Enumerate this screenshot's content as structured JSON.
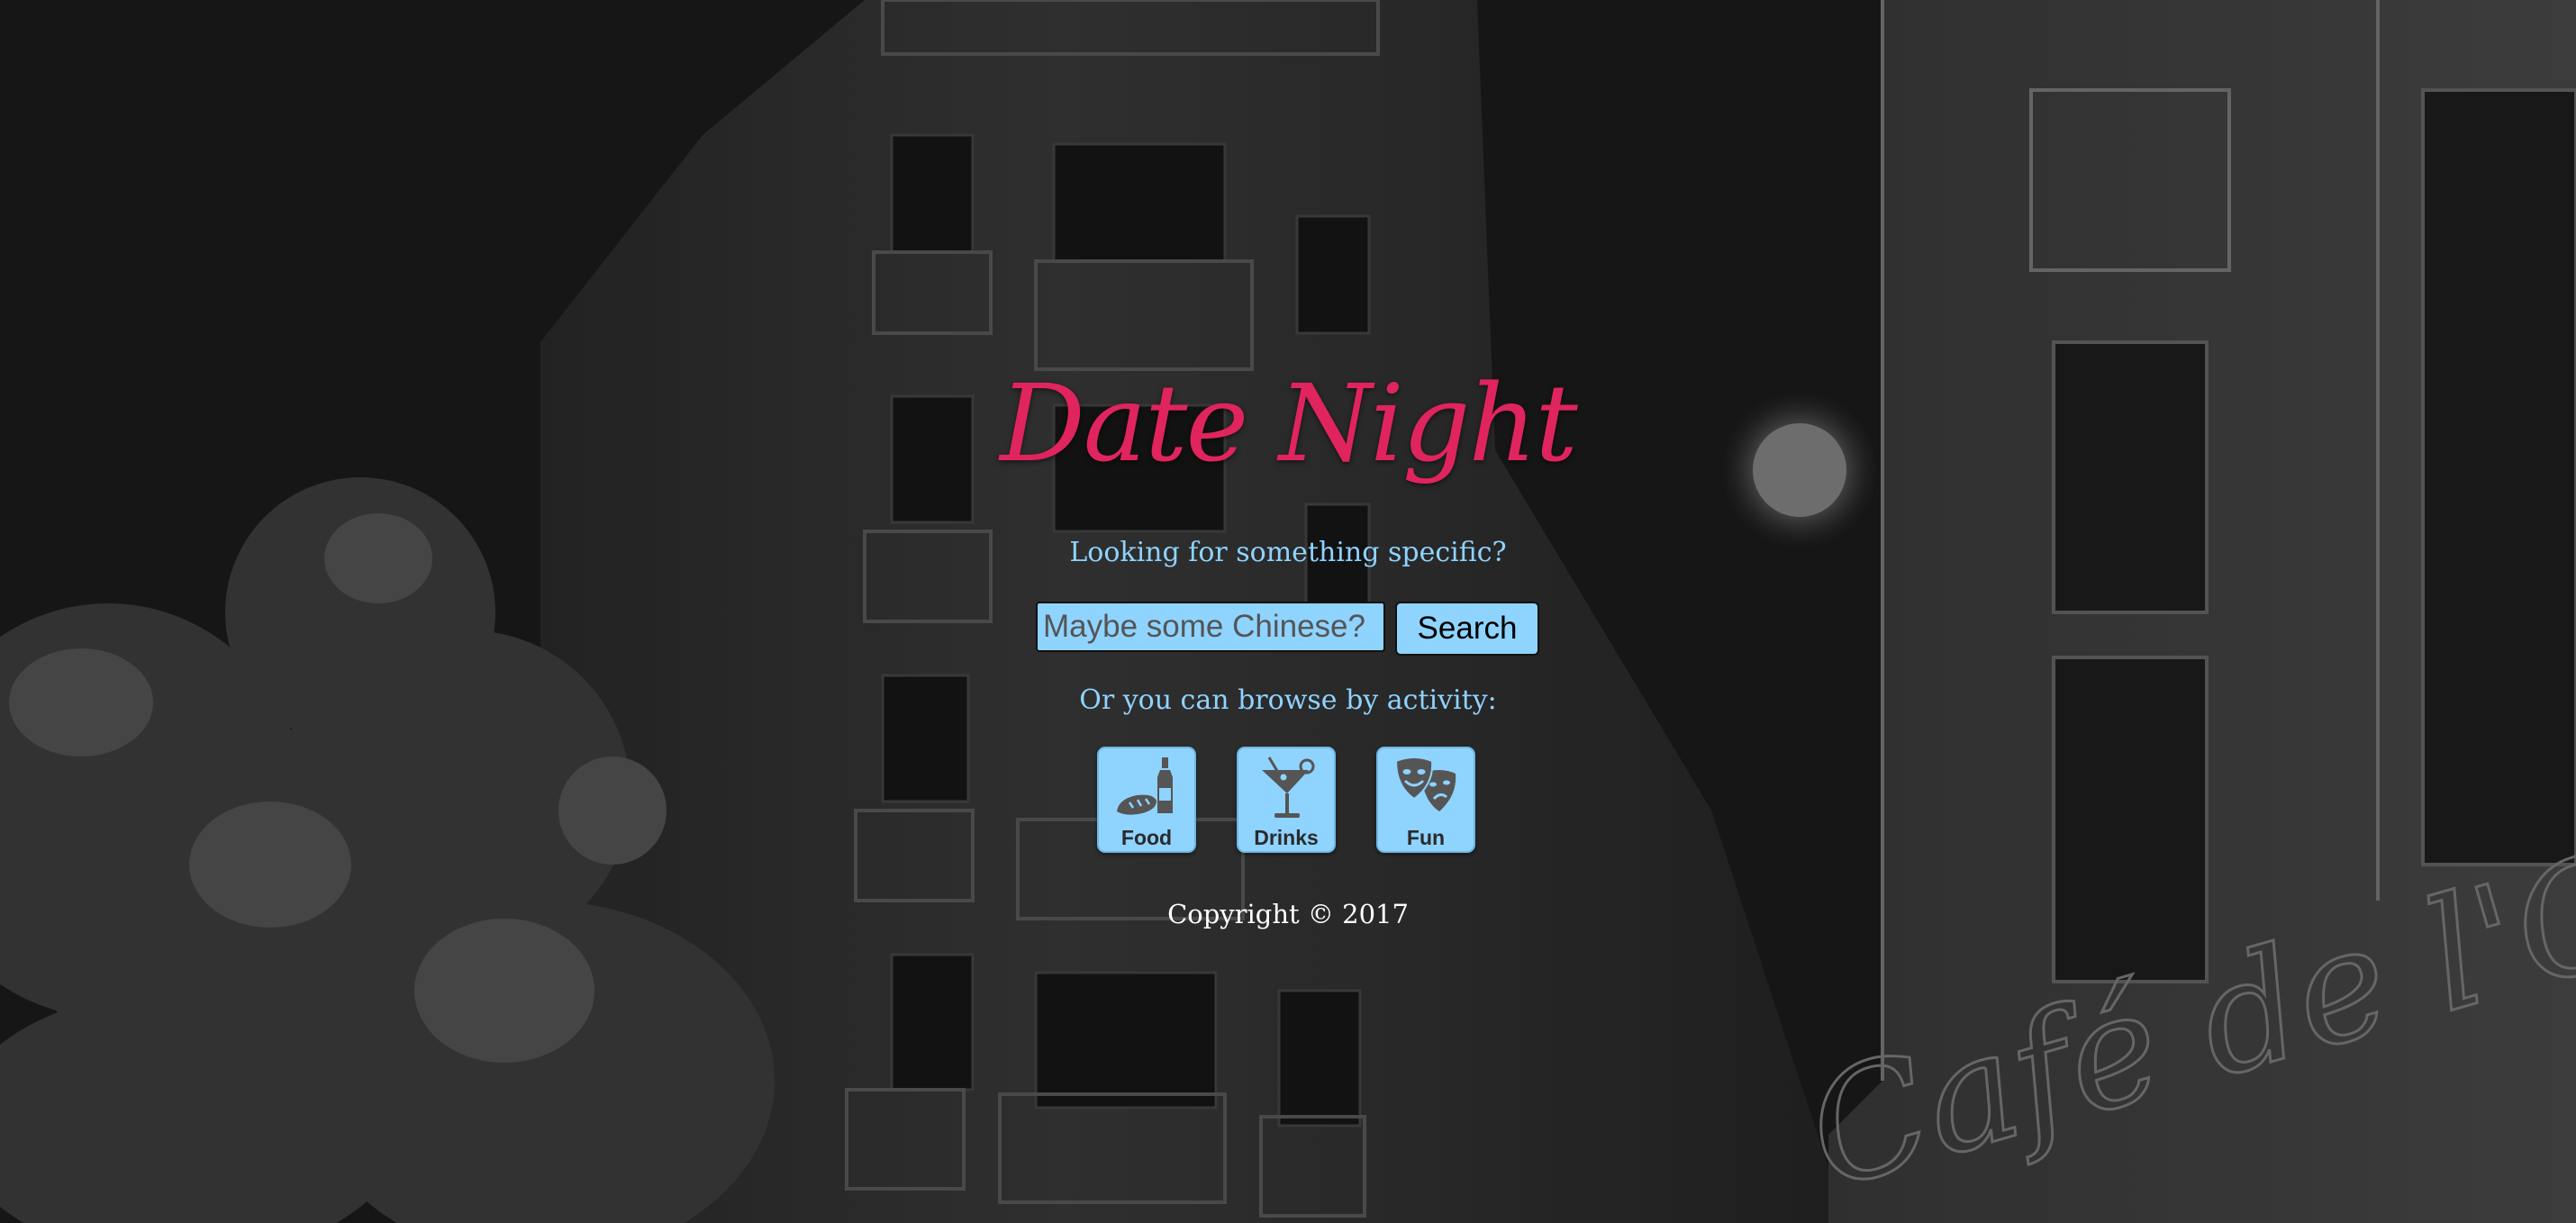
{
  "site": {
    "title": "Date Night",
    "search_prompt": "Looking for something specific?",
    "browse_prompt": "Or you can browse by activity:",
    "copyright": "Copyright © 2017"
  },
  "search": {
    "placeholder": "Maybe some Chinese?",
    "value": "",
    "button_label": "Search"
  },
  "activities": [
    {
      "label": "Food",
      "icon": "bread-wine-icon"
    },
    {
      "label": "Drinks",
      "icon": "cocktail-icon"
    },
    {
      "label": "Fun",
      "icon": "theater-masks-icon"
    }
  ],
  "background": {
    "description_icon": "night-street-photo",
    "neon_sign_text": "Café de l'Oly"
  },
  "colors": {
    "title": "#e0245e",
    "accent": "#8fd3ff",
    "copyright": "#ffffff",
    "background": "#1c1c1c"
  }
}
